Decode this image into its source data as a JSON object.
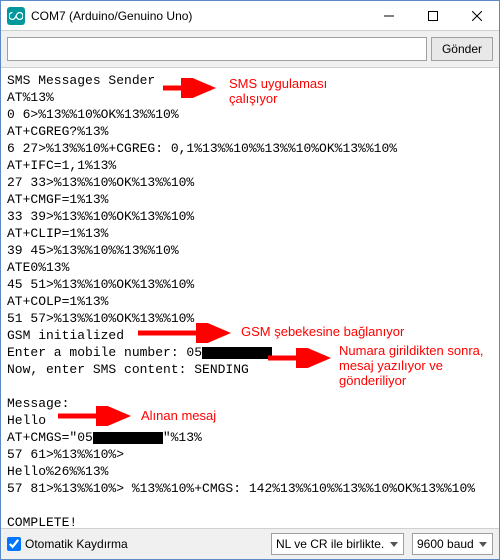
{
  "window": {
    "title": "COM7 (Arduino/Genuino Uno)"
  },
  "toolbar": {
    "input_value": "",
    "send_label": "Gönder"
  },
  "terminal": {
    "lines": [
      "SMS Messages Sender",
      "AT%13%",
      "0 6>%13%%10%OK%13%%10%",
      "AT+CGREG?%13%",
      "6 27>%13%%10%+CGREG: 0,1%13%%10%%13%%10%OK%13%%10%",
      "AT+IFC=1,1%13%",
      "27 33>%13%%10%OK%13%%10%",
      "AT+CMGF=1%13%",
      "33 39>%13%%10%OK%13%%10%",
      "AT+CLIP=1%13%",
      "39 45>%13%%10%%13%%10%",
      "ATE0%13%",
      "45 51>%13%%10%OK%13%%10%",
      "AT+COLP=1%13%",
      "51 57>%13%%10%OK%13%%10%",
      "GSM initialized",
      "Enter a mobile number: 05",
      "Now, enter SMS content: SENDING",
      "",
      "Message:",
      "Hello",
      "AT+CMGS=\"05",
      "57 61>%13%%10%>",
      "Hello%26%%13%",
      "57 81>%13%%10%> %13%%10%+CMGS: 142%13%%10%%13%%10%OK%13%%10%",
      "",
      "COMPLETE!"
    ],
    "redacted_phone_suffix_1": "████████",
    "redacted_phone_suffix_2": "████████",
    "quote_tail": "\"%13%"
  },
  "annotations": {
    "a1": "SMS uygulaması\nçalışıyor",
    "a2": "GSM şebekesine bağlanıyor",
    "a3": "Numara girildikten sonra,\nmesaj yazılıyor ve\ngönderiliyor",
    "a4": "Alınan mesaj"
  },
  "statusbar": {
    "autoscroll": "Otomatik Kaydırma",
    "lineending": "NL ve CR ile birlikte.",
    "baud": "9600 baud"
  }
}
